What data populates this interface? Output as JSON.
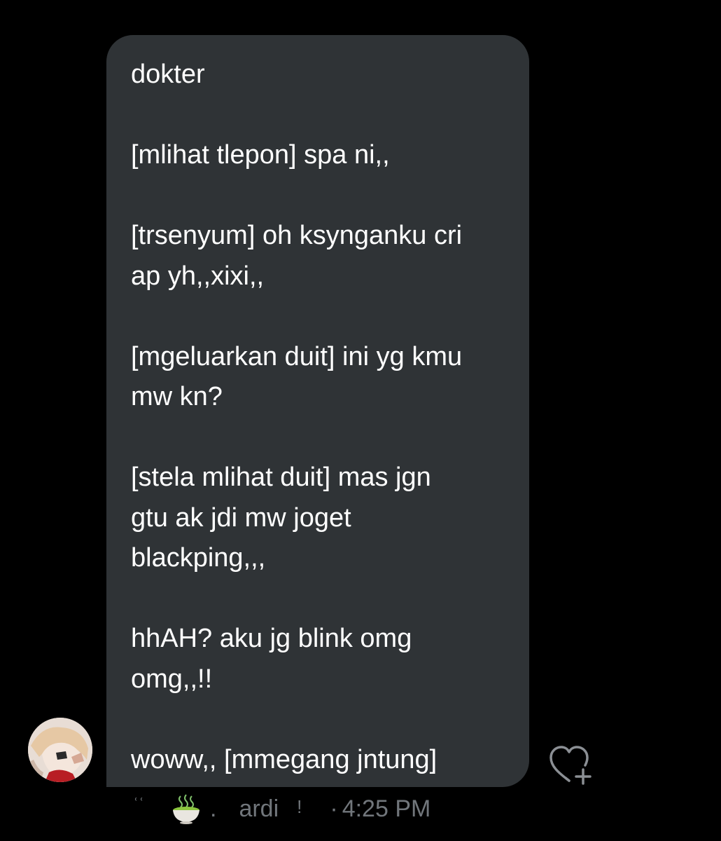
{
  "message": {
    "text": "dokter\n\n[mlihat tlepon] spa ni,,\n\n[trsenyum] oh ksynganku cri\nap yh,,xixi,,\n\n[mgeluarkan duit] ini yg kmu\nmw kn?\n\n[stela mlihat duit] mas jgn\ngtu ak jdi mw joget\nblackping,,,\n\nhhAH? aku jg blink omg\nomg,,!!\n\nwoww,, [mmegang jntung]"
  },
  "meta": {
    "quote_mark": "ʿʿ",
    "emoji_icon": "matcha-bowl-icon",
    "dot": ".",
    "display_name": "ardi",
    "exclamation": "!",
    "separator": "·",
    "time": "4:25 PM"
  },
  "reaction": {
    "icon": "heart-plus-icon"
  },
  "colors": {
    "background": "#000000",
    "bubble": "#2f3336",
    "text": "#ffffff",
    "meta_text": "#71767b"
  }
}
